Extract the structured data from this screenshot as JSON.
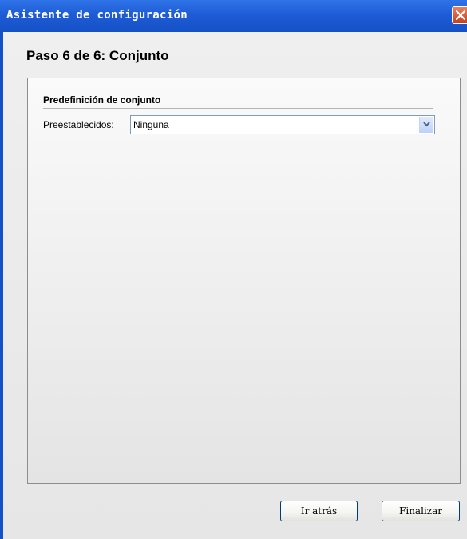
{
  "window": {
    "title": "Asistente de configuración"
  },
  "step": {
    "title": "Paso 6 de 6: Conjunto"
  },
  "group": {
    "title": "Predefinición de conjunto"
  },
  "preset_field": {
    "label": "Preestablecidos:",
    "selected": "Ninguna"
  },
  "buttons": {
    "back": "Ir atrás",
    "finish": "Finalizar"
  },
  "icons": {
    "close": "close-icon",
    "dropdown": "chevron-down-icon"
  },
  "colors": {
    "titlebar": "#1e5cd6",
    "close_button": "#d35a34"
  }
}
